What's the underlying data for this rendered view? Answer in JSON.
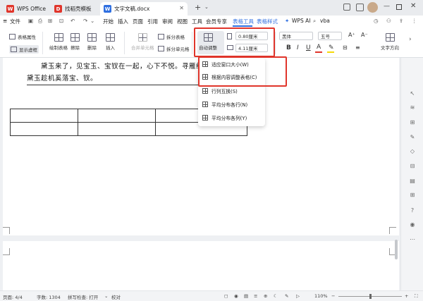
{
  "tabs": [
    {
      "label": "WPS Office",
      "icon": "wps-logo-icon",
      "color": "#e0352b"
    },
    {
      "label": "找稻壳模板",
      "icon": "docer-icon",
      "color": "#e0352b"
    },
    {
      "label": "文字文稿.docx",
      "icon": "word-doc-icon",
      "color": "#2f6fe0"
    }
  ],
  "menu": {
    "file": "文件",
    "items": [
      "开始",
      "插入",
      "页面",
      "引用",
      "审阅",
      "视图",
      "工具",
      "会员专享"
    ],
    "table_tools": "表格工具",
    "table_style": "表格样式",
    "wps_ai": "WPS AI",
    "search": "vba"
  },
  "ribbon": {
    "table_props": "表格属性",
    "show_grid": "显示虚框",
    "draw_table": "绘制表格",
    "erase": "擦除",
    "delete": "删除",
    "insert": "插入",
    "merge_cells": "合并单元格",
    "split_table": "拆分表格",
    "split_cells": "拆分单元格",
    "auto_fit": "自动调整",
    "width_value": "0.80厘米",
    "height_value": "4.11厘米",
    "font_name": "黑体",
    "font_size": "五号",
    "text_direction": "文字方向",
    "bold": "B",
    "italic": "I",
    "underline": "U",
    "font_color": "A"
  },
  "document": {
    "line1": "黛玉来了，见宝玉、宝钗在一起，心下不悦。寻雁给",
    "line2": "黛玉趁机奚落宝、钗。"
  },
  "dropdown": {
    "items": [
      "适应窗口大小(W)",
      "根据内容调整表格(C)",
      "行列互换(S)",
      "平均分布各行(N)",
      "平均分布各列(Y)"
    ]
  },
  "status": {
    "page": "页面: 4/4",
    "words": "字数: 1304",
    "spell": "拼写检查: 打开",
    "proof": "校对",
    "zoom": "110%"
  },
  "colors": {
    "accent": "#2f6fe0",
    "highlight_box": "#e0352b",
    "font_color_bar": "#e0352b",
    "highlight_bar": "#f5d90a"
  }
}
